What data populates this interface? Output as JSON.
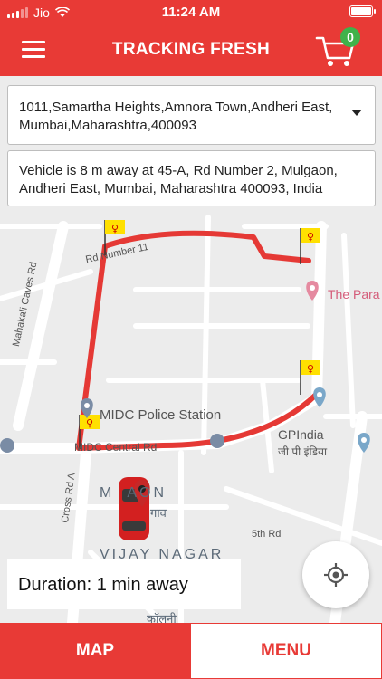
{
  "status": {
    "carrier": "Jio",
    "time": "11:24 AM"
  },
  "header": {
    "title": "TRACKING FRESH",
    "menu_icon": "hamburger-icon",
    "cart_icon": "cart-icon",
    "cart_count": "0"
  },
  "addresses": {
    "selected": "1011,Samartha Heights,Amnora Town,Andheri East, Mumbai,Maharashtra,400093",
    "vehicle_status": "Vehicle is 8 m away at 45-A, Rd Number 2, Mulgaon, Andheri East, Mumbai, Maharashtra 400093, India"
  },
  "map": {
    "labels": {
      "road_1": "Rd Number 11",
      "road_2": "Mahakali Caves Rd",
      "road_3": "MIDC Central Rd",
      "road_4": "Cross Rd A",
      "road_5": "5th Rd",
      "place_1": "MIDC Police Station",
      "place_2": "GPIndia",
      "place_2_hi": "जी पी इंडिया",
      "place_3": "The Para",
      "area_1": "M  AON",
      "area_1_hi": "गाव",
      "area_2": "VIJAY NAGAR",
      "area_2_hi": "कॉलनी"
    },
    "route_color": "#e53935",
    "flag_color": "#ffe000"
  },
  "duration": "Duration: 1 min away",
  "tabs": {
    "map": "MAP",
    "menu": "MENU"
  },
  "colors": {
    "primary": "#e83a36",
    "badge": "#3fb24a"
  }
}
